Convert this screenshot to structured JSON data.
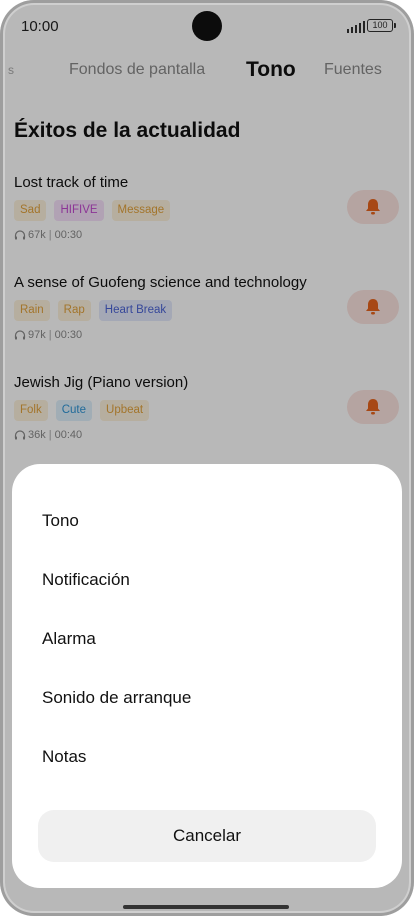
{
  "status_bar": {
    "time": "10:00",
    "battery": "100"
  },
  "tabs": [
    {
      "label": "s"
    },
    {
      "label": "Fondos de pantalla"
    },
    {
      "label": "Tono"
    },
    {
      "label": "Fuentes"
    }
  ],
  "section_title": "Éxitos de la actualidad",
  "songs": [
    {
      "title": "Lost track of time",
      "tags": [
        {
          "label": "Sad",
          "color": "#e2a23c",
          "bg": "#fdf2dd"
        },
        {
          "label": "HIFIVE",
          "color": "#c24ad0",
          "bg": "#f6e1fa"
        },
        {
          "label": "Message",
          "color": "#e2a23c",
          "bg": "#fdf2dd"
        }
      ],
      "plays": "67k",
      "duration": "00:30"
    },
    {
      "title": "A sense of Guofeng science and technology",
      "tags": [
        {
          "label": "Rain",
          "color": "#e2a23c",
          "bg": "#fdf2dd"
        },
        {
          "label": "Rap",
          "color": "#e2a23c",
          "bg": "#fdf2dd"
        },
        {
          "label": "Heart Break",
          "color": "#4a63d6",
          "bg": "#e4e9fb"
        }
      ],
      "plays": "97k",
      "duration": "00:30"
    },
    {
      "title": "Jewish Jig (Piano version)",
      "tags": [
        {
          "label": "Folk",
          "color": "#e2a23c",
          "bg": "#fdf2dd"
        },
        {
          "label": "Cute",
          "color": "#2f95d6",
          "bg": "#dff0fb"
        },
        {
          "label": "Upbeat",
          "color": "#e2a23c",
          "bg": "#fdf2dd"
        }
      ],
      "plays": "36k",
      "duration": "00:40"
    }
  ],
  "sheet": {
    "options": [
      "Tono",
      "Notificación",
      "Alarma",
      "Sonido de arranque",
      "Notas"
    ],
    "cancel_label": "Cancelar"
  },
  "colors": {
    "accent": "#e8651e",
    "bell_bg": "#fbe3df"
  },
  "icons": {
    "bell": "bell-icon",
    "headphones": "headphones-icon"
  }
}
